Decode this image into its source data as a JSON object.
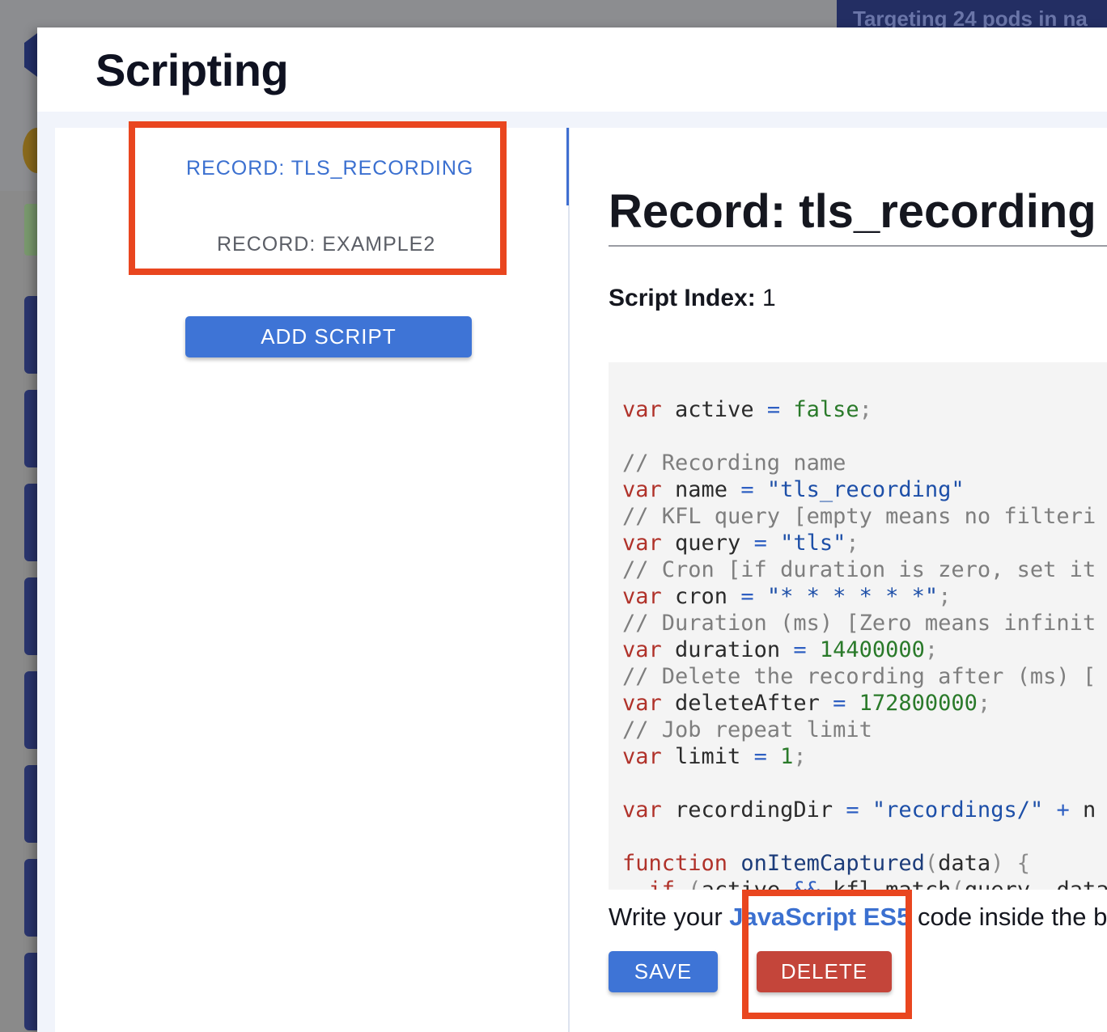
{
  "background": {
    "banner_text": "Targeting 24 pods in na"
  },
  "modal": {
    "title": "Scripting"
  },
  "script_list": {
    "items": [
      {
        "label": "RECORD: TLS_RECORDING",
        "active": true
      },
      {
        "label": "RECORD: EXAMPLE2",
        "active": false
      }
    ],
    "add_button": "ADD SCRIPT"
  },
  "detail": {
    "title": "Record: tls_recording",
    "index_label": "Script Index:",
    "index_value": "1",
    "code_lines": [
      "var active = false;",
      "",
      "// Recording name",
      "var name = \"tls_recording\"",
      "// KFL query [empty means no filteri",
      "var query = \"tls\";",
      "// Cron [if duration is zero, set it",
      "var cron = \"* * * * * *\";",
      "// Duration (ms) [Zero means infinit",
      "var duration = 14400000;",
      "// Delete the recording after (ms) [",
      "var deleteAfter = 172800000;",
      "// Job repeat limit",
      "var limit = 1;",
      "",
      "var recordingDir = \"recordings/\" + n",
      "",
      "function onItemCaptured(data) {",
      "  if (active && kfl.match(query, data"
    ],
    "help_prefix": "Write your ",
    "help_link": "JavaScript ES5",
    "help_suffix": " code inside the b",
    "save_button": "SAVE",
    "delete_button": "DELETE"
  },
  "colors": {
    "accent": "#3e74d6",
    "danger": "#c4453a",
    "highlight": "#e9461f"
  }
}
